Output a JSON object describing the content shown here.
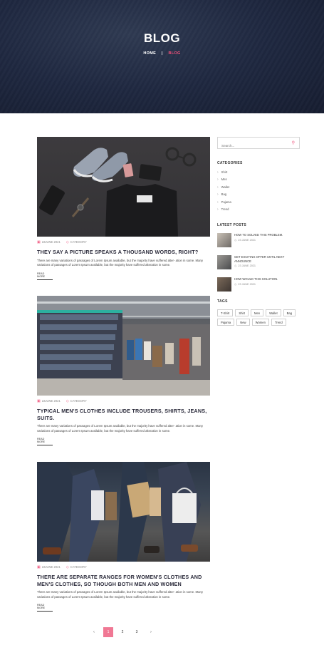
{
  "hero": {
    "title": "BLOG",
    "crumb_home": "HOME",
    "crumb_sep": "|",
    "crumb_current": "BLOG"
  },
  "posts": [
    {
      "date": "22JUNE 2021",
      "category": "CATEGORY",
      "title": "THEY SAY A PICTURE SPEAKS A THOUSAND WORDS, RIGHT?",
      "excerpt": "There are many variations of passages of Lorem Ipsum available, but the majority have suffered alter- ation in some. Many variations of passages of Lorem Ipsum available, but the majority have suffered alteration in some.",
      "read_more": "READ MORE"
    },
    {
      "date": "22JUNE 2021",
      "category": "CATEGORY",
      "title": "TYPICAL MEN'S CLOTHES INCLUDE TROUSERS, SHIRTS, JEANS, SUITS.",
      "excerpt": "There are many variations of passages of Lorem Ipsum available, but the majority have suffered alter- ation in some. Many variations of passages of Lorem Ipsum available, but the majority have suffered alteration in some.",
      "read_more": "READ MORE"
    },
    {
      "date": "22JUNE 2021",
      "category": "CATEGORY",
      "title": "THERE ARE SEPARATE RANGES FOR WOMEN'S CLOTHES AND MEN'S CLOTHES, SO THOUGH BOTH MEN AND WOMEN",
      "excerpt": "There are many variations of passages of Lorem Ipsum available, but the majority have suffered alter- ation in some. Many variations of passages of Lorem Ipsum available, but the majority have suffered alteration in some.",
      "read_more": "READ MORE"
    }
  ],
  "sidebar": {
    "search_placeholder": "Search...",
    "categories_heading": "CATEGORIES",
    "categories": [
      "Shirt",
      "Men",
      "Wallet",
      "Bag",
      "Pajama",
      "Trend"
    ],
    "latest_heading": "LATEST POSTS",
    "latest": [
      {
        "title": "HOW TO SOLVED THIS PROBLEM.",
        "date": "23 JUNE 2021"
      },
      {
        "title": "GET EXCITING OFFER UNTIL NEXT ANNOUNCE",
        "date": "23 JUNE 2021"
      },
      {
        "title": "HOW WOULD THIS SOLUTION.",
        "date": "23 JUNE 2021"
      }
    ],
    "tags_heading": "TAGS",
    "tags": [
      "T-Shirt",
      "Shirt",
      "Men",
      "Wallet",
      "Bag",
      "Pajama",
      "New",
      "Women",
      "Trend"
    ]
  },
  "pagination": {
    "prev": "‹",
    "pages": [
      "1",
      "2",
      "3"
    ],
    "next": "›"
  },
  "colors": {
    "accent": "#f0507a",
    "hero_bg": "#1f2840"
  }
}
